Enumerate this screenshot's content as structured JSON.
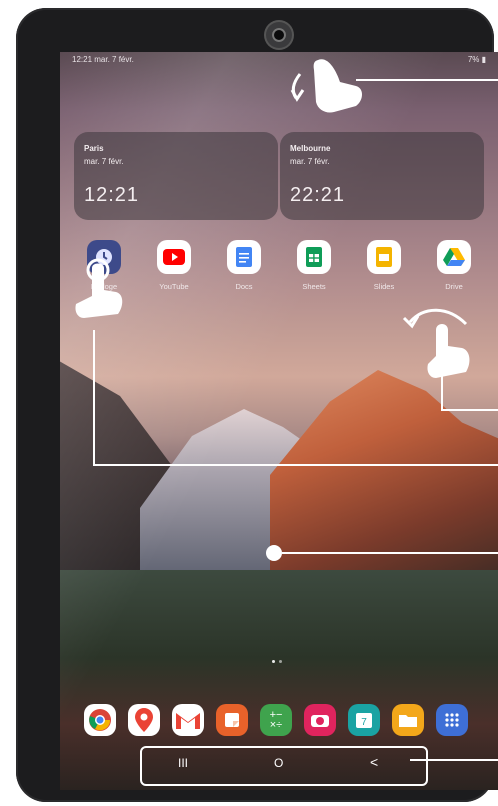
{
  "status_bar": {
    "left": "12:21  mar. 7 févr.",
    "right": "7%"
  },
  "clocks": [
    {
      "city": "Paris",
      "date": "mar. 7 févr.",
      "time": "12:21"
    },
    {
      "city": "Melbourne",
      "date": "mar. 7 févr.",
      "time": "22:21"
    }
  ],
  "apps": [
    {
      "label": "Horloge",
      "icon": "clock-icon",
      "color": "#3d4a8a"
    },
    {
      "label": "YouTube",
      "icon": "youtube-icon",
      "color": "#ffffff"
    },
    {
      "label": "Docs",
      "icon": "docs-icon",
      "color": "#ffffff"
    },
    {
      "label": "Sheets",
      "icon": "sheets-icon",
      "color": "#ffffff"
    },
    {
      "label": "Slides",
      "icon": "slides-icon",
      "color": "#ffffff"
    },
    {
      "label": "Drive",
      "icon": "drive-icon",
      "color": "#ffffff"
    }
  ],
  "dock": [
    {
      "icon": "chrome-icon",
      "color": "#ffffff"
    },
    {
      "icon": "maps-icon",
      "color": "#ffffff"
    },
    {
      "icon": "gmail-icon",
      "color": "#ffffff"
    },
    {
      "icon": "notes-icon",
      "color": "#e8622a"
    },
    {
      "icon": "calculator-icon",
      "color": "#3fa34d"
    },
    {
      "icon": "camera-icon",
      "color": "#e0245e"
    },
    {
      "icon": "calendar-icon",
      "color": "#1aa3a3"
    },
    {
      "icon": "files-icon",
      "color": "#f3a71a"
    },
    {
      "icon": "apps-grid-icon",
      "color": "#3e6fd6"
    }
  ],
  "nav": {
    "recents": "III",
    "home": "O",
    "back": "<"
  }
}
